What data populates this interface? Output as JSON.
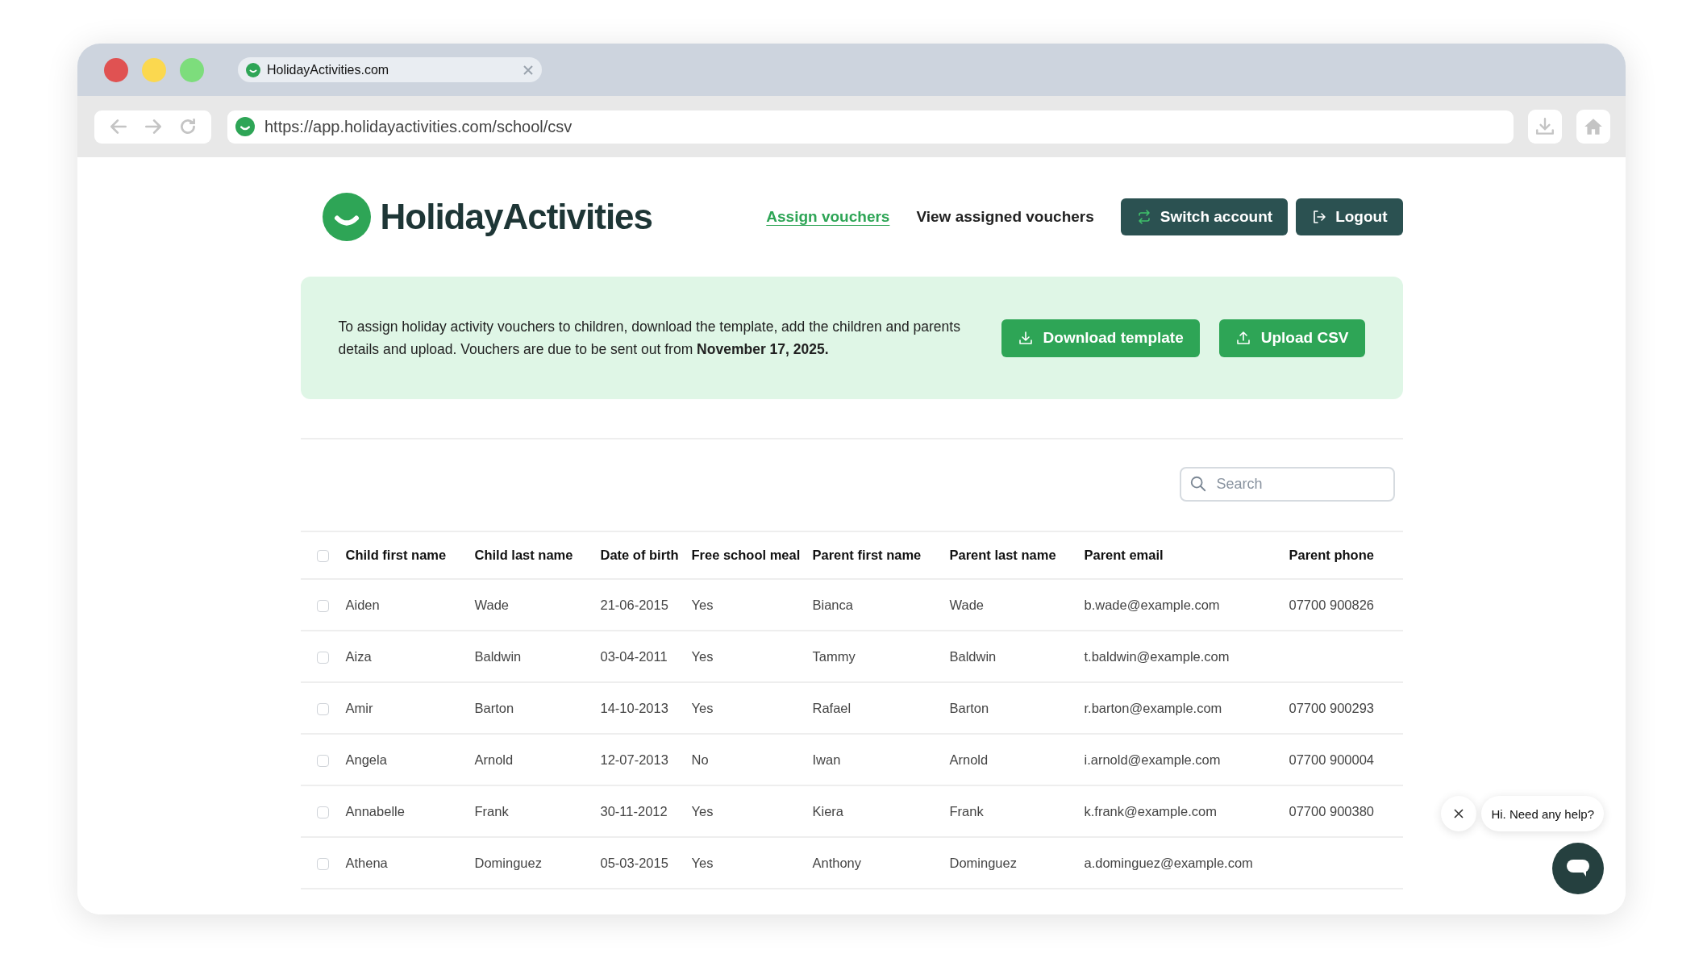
{
  "browser": {
    "tab": {
      "title": "HolidayActivities.com"
    },
    "address": "https://app.holidayactivities.com/school/csv"
  },
  "header": {
    "logo": "HolidayActivities",
    "nav": [
      {
        "label": "Assign vouchers",
        "selected": true
      },
      {
        "label": "View assigned vouchers",
        "selected": false
      }
    ],
    "buttons": [
      {
        "label": "Switch account",
        "kind": "switch"
      },
      {
        "label": "Logout",
        "kind": "logout"
      }
    ]
  },
  "banner": {
    "text": "To assign holiday activity vouchers to children, download the template, add the children and parents details and upload. Vouchers are due to be sent out from **November 17, 2025.**",
    "buttons": [
      {
        "label": "Download template",
        "kind": "download"
      },
      {
        "label": "Upload CSV",
        "kind": "upload"
      }
    ]
  },
  "search": {
    "placeholder": "Search"
  },
  "table": {
    "select_all_checked": false,
    "columns": [
      "Child first name",
      "Child last name",
      "Date of birth",
      "Free school meal",
      "Parent first name",
      "Parent last name",
      "Parent email",
      "Parent phone"
    ],
    "rows": [
      {
        "checked": false,
        "cells": [
          "Aiden",
          "Wade",
          "21-06-2015",
          "Yes",
          "Bianca",
          "Wade",
          "b.wade@example.com",
          "07700 900826"
        ]
      },
      {
        "checked": false,
        "cells": [
          "Aiza",
          "Baldwin",
          "03-04-2011",
          "Yes",
          "Tammy",
          "Baldwin",
          "t.baldwin@example.com",
          ""
        ]
      },
      {
        "checked": false,
        "cells": [
          "Amir",
          "Barton",
          "14-10-2013",
          "Yes",
          "Rafael",
          "Barton",
          "r.barton@example.com",
          "07700 900293"
        ]
      },
      {
        "checked": false,
        "cells": [
          "Angela",
          "Arnold",
          "12-07-2013",
          "No",
          "Iwan",
          "Arnold",
          "i.arnold@example.com",
          "07700 900004"
        ]
      },
      {
        "checked": false,
        "cells": [
          "Annabelle",
          "Frank",
          "30-11-2012",
          "Yes",
          "Kiera",
          "Frank",
          "k.frank@example.com",
          "07700 900380"
        ]
      },
      {
        "checked": false,
        "cells": [
          "Athena",
          "Dominguez",
          "05-03-2015",
          "Yes",
          "Anthony",
          "Dominguez",
          "a.dominguez@example.com",
          ""
        ]
      }
    ]
  },
  "chat": {
    "message": "Hi. Need any help?"
  }
}
